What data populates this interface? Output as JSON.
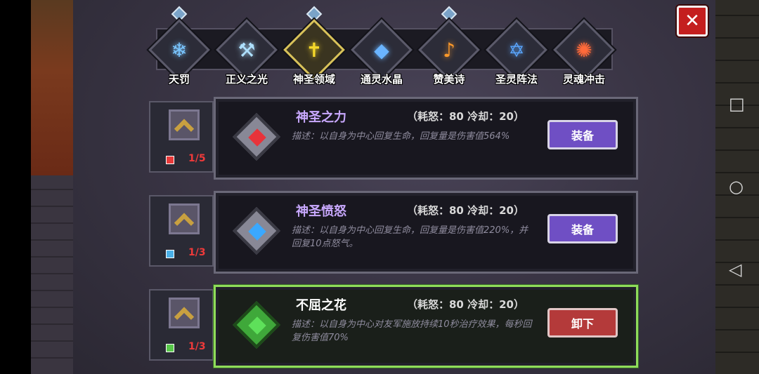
{
  "tabs": [
    {
      "label": "天罚",
      "color": "#7ac6ff",
      "symbol": "❄",
      "gem": true
    },
    {
      "label": "正义之光",
      "color": "#aee0ff",
      "symbol": "⚒",
      "gem": false
    },
    {
      "label": "神圣领域",
      "color": "#f5d82a",
      "symbol": "✝",
      "gem": true,
      "active": true
    },
    {
      "label": "通灵水晶",
      "color": "#6ab4ff",
      "symbol": "◆",
      "gem": false
    },
    {
      "label": "赞美诗",
      "color": "#ff9a2a",
      "symbol": "♪",
      "gem": true
    },
    {
      "label": "圣灵阵法",
      "color": "#5aa6ff",
      "symbol": "✡",
      "gem": false
    },
    {
      "label": "灵魂冲击",
      "color": "#ff6a3a",
      "symbol": "✺",
      "gem": false
    }
  ],
  "skills": [
    {
      "name": "神圣之力",
      "cost": "（耗怒：80  冷却：20）",
      "desc": "描述：以自身为中心回复生命，回复量是伤害值564%",
      "level": "1/5",
      "core_color": "#e8333a",
      "level_icon_color": "#e83a3a",
      "button": "装备",
      "equipped": false
    },
    {
      "name": "神圣愤怒",
      "cost": "（耗怒：80  冷却：20）",
      "desc": "描述：以自身为中心回复生命，回复量是伤害值220%，并回复10点怒气。",
      "level": "1/3",
      "core_color": "#3aa8ff",
      "level_icon_color": "#4ab0e8",
      "button": "装备",
      "equipped": false
    },
    {
      "name": "不屈之花",
      "cost": "（耗怒：80  冷却：20）",
      "desc": "描述：以自身为中心对友军施放持续10秒治疗效果，每秒回复伤害值70%",
      "level": "1/3",
      "core_color": "#5ee05a",
      "level_icon_color": "#58c84a",
      "button": "卸下",
      "equipped": true
    }
  ],
  "close_label": "✕",
  "nav": {
    "square": "□",
    "circle": "○",
    "back": "◁"
  }
}
